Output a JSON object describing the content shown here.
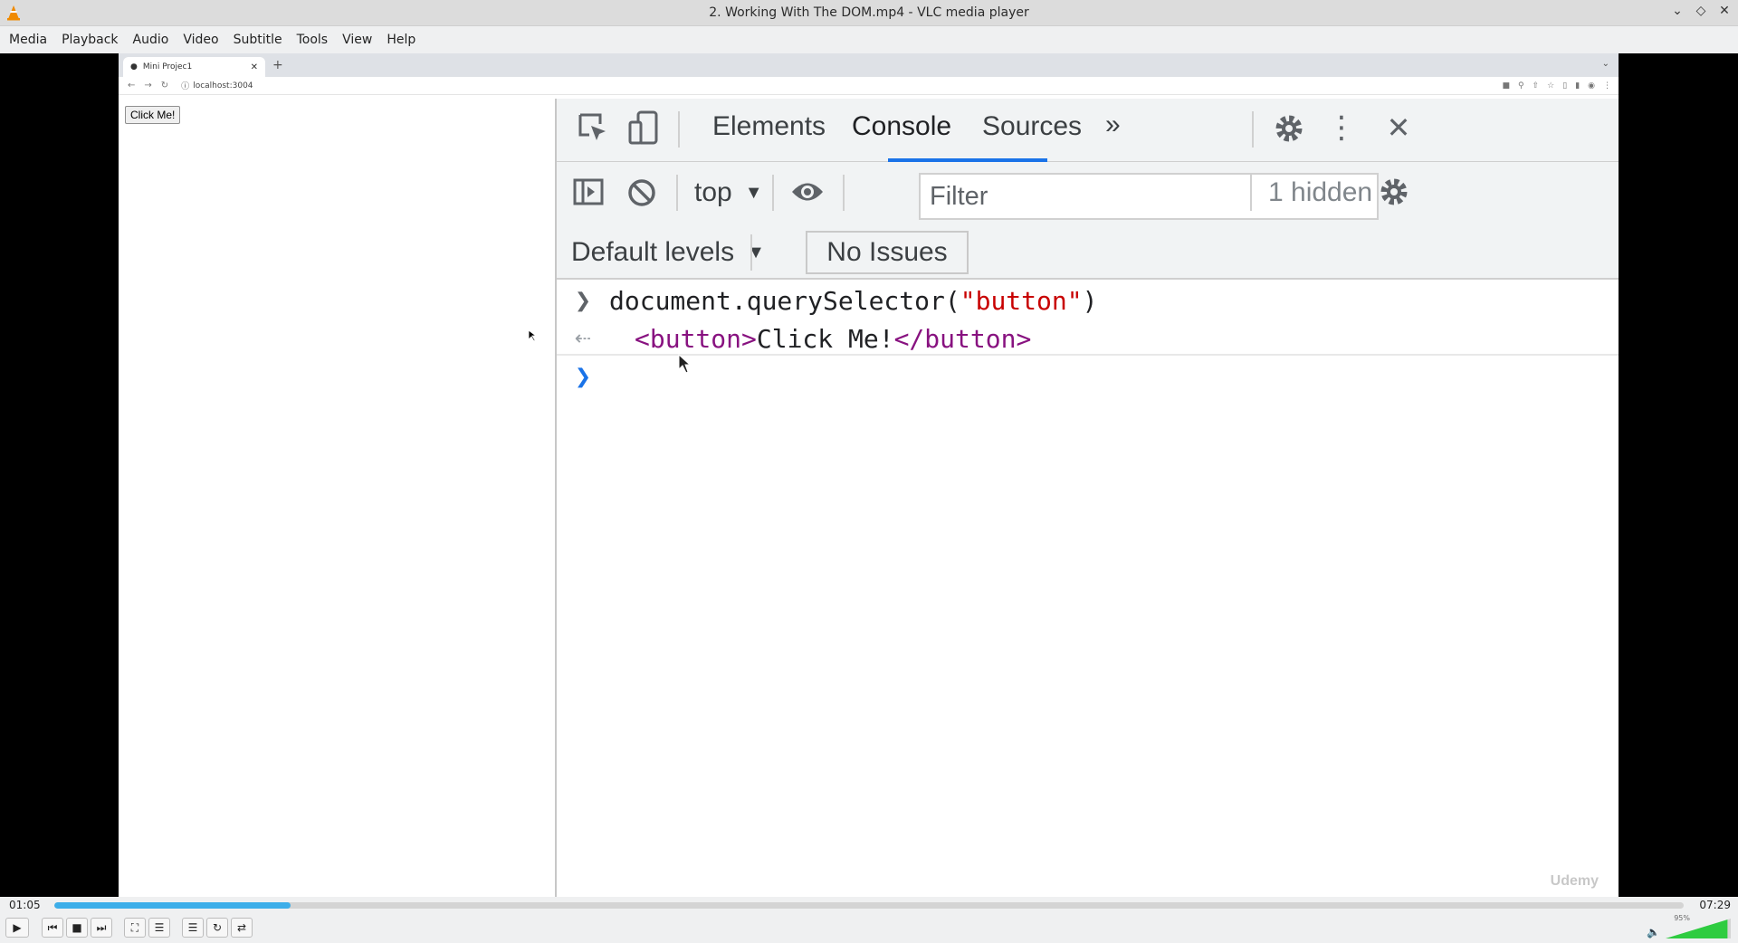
{
  "window": {
    "title": "2. Working With The DOM.mp4 - VLC media player",
    "controls": [
      "minimize",
      "maximize",
      "close"
    ]
  },
  "menu": [
    "Media",
    "Playback",
    "Audio",
    "Video",
    "Subtitle",
    "Tools",
    "View",
    "Help"
  ],
  "browser": {
    "tab_title": "Mini Projec1",
    "address": "localhost:3004",
    "page_button": "Click Me!"
  },
  "devtools": {
    "tabs": [
      "Elements",
      "Console",
      "Sources"
    ],
    "active_tab": "Console",
    "context": "top",
    "filter_placeholder": "Filter",
    "hidden": "1 hidden",
    "levels": "Default levels",
    "issues": "No Issues",
    "console": {
      "input_prefix": "document.querySelector(",
      "input_arg": "\"button\"",
      "input_suffix": ")",
      "output_open": "<button>",
      "output_text": "Click Me!",
      "output_close": "</button>"
    },
    "watermark": "Udemy"
  },
  "player": {
    "elapsed": "01:05",
    "total": "07:29",
    "progress": 0.145,
    "volume": "95%",
    "volume_level": 0.95,
    "colors": {
      "accent": "#3daee9",
      "volume": "#2ecc40"
    }
  }
}
